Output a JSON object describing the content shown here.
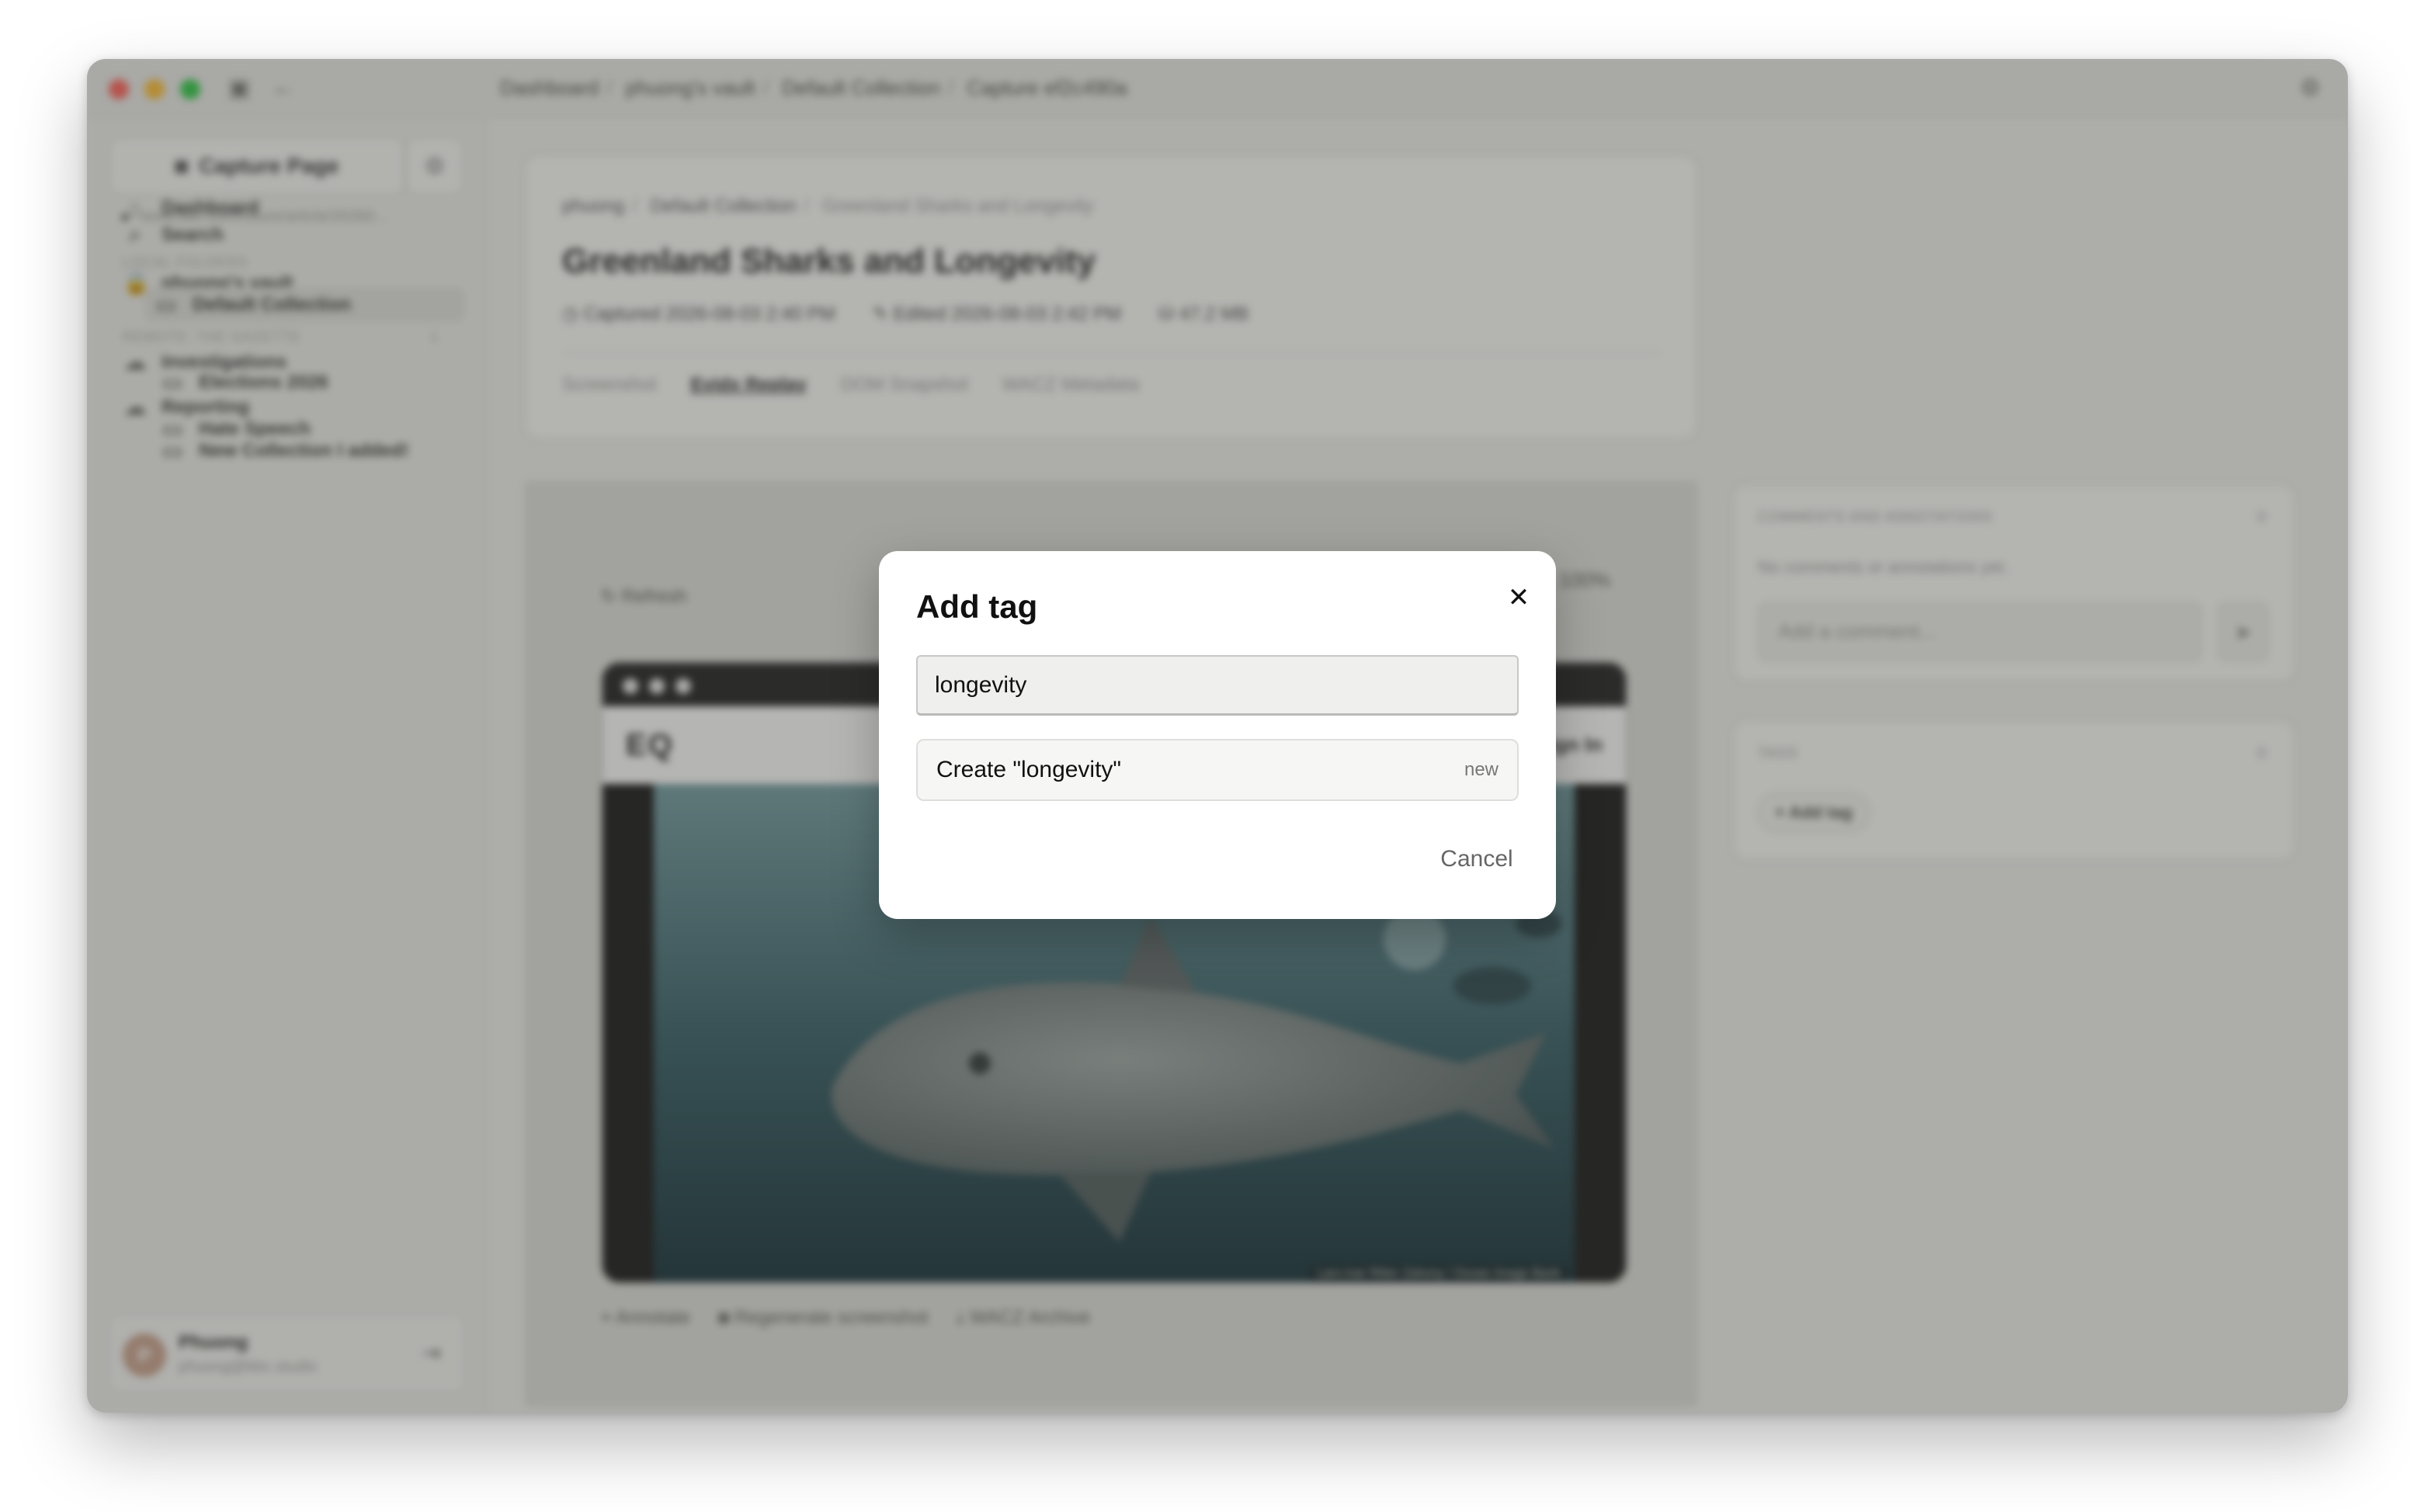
{
  "titlebar": {
    "breadcrumbs": [
      "Dashboard",
      "phuong's vault",
      "Default Collection",
      "Capture ef2c490a"
    ]
  },
  "sidebar": {
    "capture_label": "Capture Page",
    "url": "www.bbc.com/future/article/20260...",
    "nav": [
      {
        "label": "Dashboard",
        "icon": "home-icon"
      },
      {
        "label": "Search",
        "icon": "search-icon"
      }
    ],
    "local_section": "LOCAL FOLDERS",
    "vault": "phuong's vault",
    "default_collection": "Default Collection",
    "remote_section": "REMOTE: THE GAZETTE",
    "remote_count": "1",
    "folders": [
      {
        "label": "Investigations",
        "level": 0
      },
      {
        "label": "Elections 2026",
        "level": 1
      },
      {
        "label": "Reporting",
        "level": 0
      },
      {
        "label": "Hate Speech",
        "level": 1
      },
      {
        "label": "New Collection I added!",
        "level": 1
      }
    ],
    "user": {
      "initial": "P",
      "name": "Phuong",
      "email": "phuong@bbc.studio"
    }
  },
  "header": {
    "breadcrumbs": [
      "phuong",
      "Default Collection",
      "Greenland Sharks and Longevity"
    ],
    "title": "Greenland Sharks and Longevity",
    "captured": "Captured 2026-08-03 2:40 PM",
    "edited": "Edited 2026-08-03 2:42 PM",
    "size": "47.2 MB",
    "tabs": [
      "Screenshot",
      "Evidx Replay",
      "DOM Snapshot",
      "WACZ Metadata"
    ]
  },
  "viewer": {
    "refresh": "Refresh",
    "zoom": "100%",
    "brand": "EQ",
    "signin": "Sign In",
    "photo_credit": "Lars-Ivar Ritter Zahony / Ocean Image Bank",
    "actions": [
      "Annotate",
      "Regenerate screenshot",
      "WACZ Archive"
    ]
  },
  "comments": {
    "label": "COMMENTS AND ANNOTATIONS",
    "count": "0",
    "empty": "No comments or annotations yet.",
    "placeholder": "Add a comment..."
  },
  "tags": {
    "label": "TAGS",
    "count": "0",
    "add_label": "+ Add tag"
  },
  "modal": {
    "title": "Add tag",
    "input_value": "longevity",
    "create_label": "Create \"longevity\"",
    "new_badge": "new",
    "cancel_label": "Cancel"
  }
}
